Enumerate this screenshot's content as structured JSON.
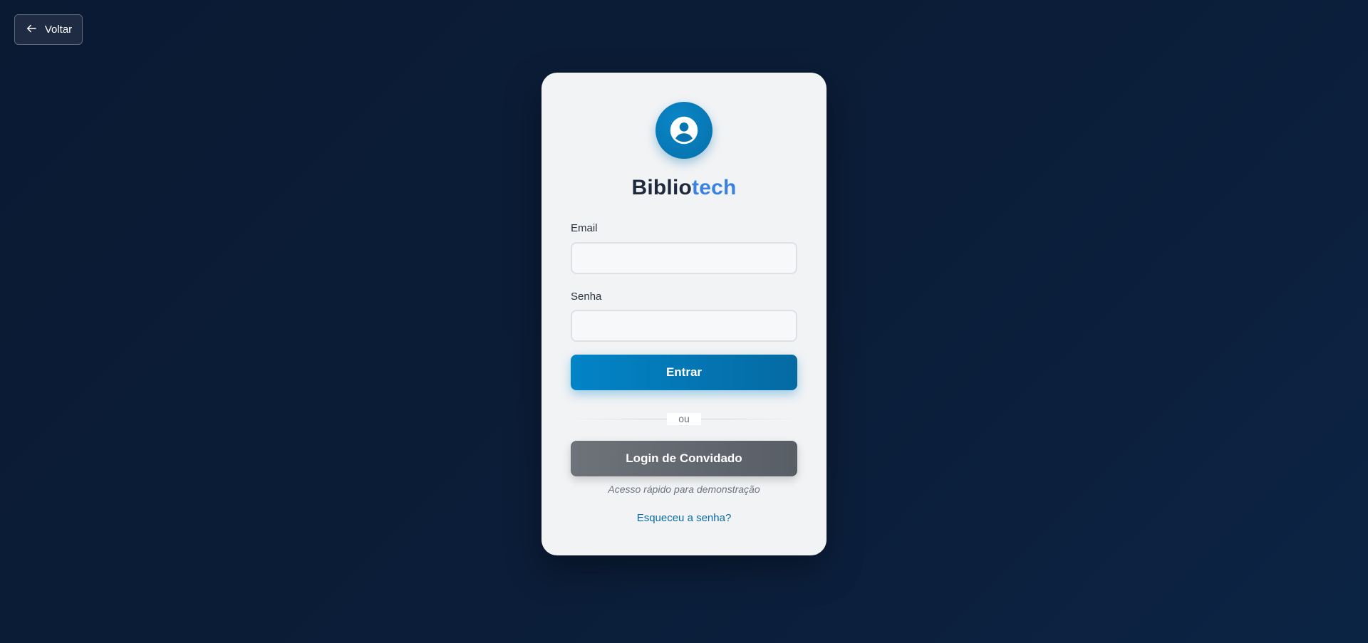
{
  "back_button": {
    "label": "Voltar",
    "icon": "arrow-left-icon"
  },
  "brand": {
    "part1": "Biblio",
    "part2": "tech"
  },
  "avatar": {
    "icon": "user-circle-icon"
  },
  "form": {
    "email_label": "Email",
    "email_value": "",
    "password_label": "Senha",
    "password_value": "",
    "submit_label": "Entrar",
    "divider_text": "ou",
    "guest_label": "Login de Convidado",
    "guest_hint": "Acesso rápido para demonstração",
    "forgot_label": "Esqueceu a senha?"
  },
  "colors": {
    "background": "#0b1d38",
    "card": "#f1f3f5",
    "primary": "#0284c7",
    "brand_accent": "#3b82e0",
    "guest": "#646a71",
    "link": "#0a6aa6"
  }
}
